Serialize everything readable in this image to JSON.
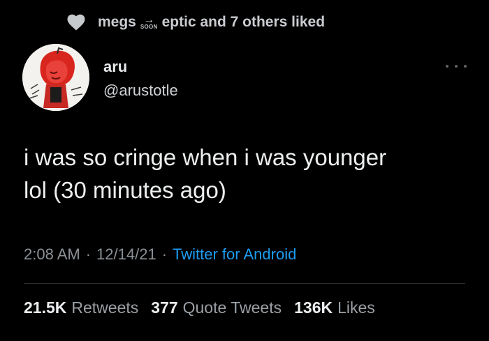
{
  "social_context": {
    "icon": "heart-icon",
    "name_first": "megs",
    "emoji": {
      "arrow": "→",
      "label": "SOON",
      "icon": "soon-arrow-emoji"
    },
    "text_rest": "eptic and 7 others liked"
  },
  "author": {
    "display_name": "aru",
    "handle": "@arustotle",
    "avatar_icon": "avatar"
  },
  "tweet": {
    "text_line1": "i was so cringe when i was younger",
    "text_line2": "lol (30 minutes ago)"
  },
  "meta": {
    "time": "2:08 AM",
    "separator": "·",
    "date": "12/14/21",
    "source": "Twitter for Android"
  },
  "stats": {
    "retweets_count": "21.5K",
    "retweets_label": "Retweets",
    "quotes_count": "377",
    "quotes_label": "Quote Tweets",
    "likes_count": "136K",
    "likes_label": "Likes"
  },
  "colors": {
    "background": "#000000",
    "link": "#1d9bf0",
    "primary_text": "#e7e9ea",
    "secondary_text": "#8b9196"
  }
}
